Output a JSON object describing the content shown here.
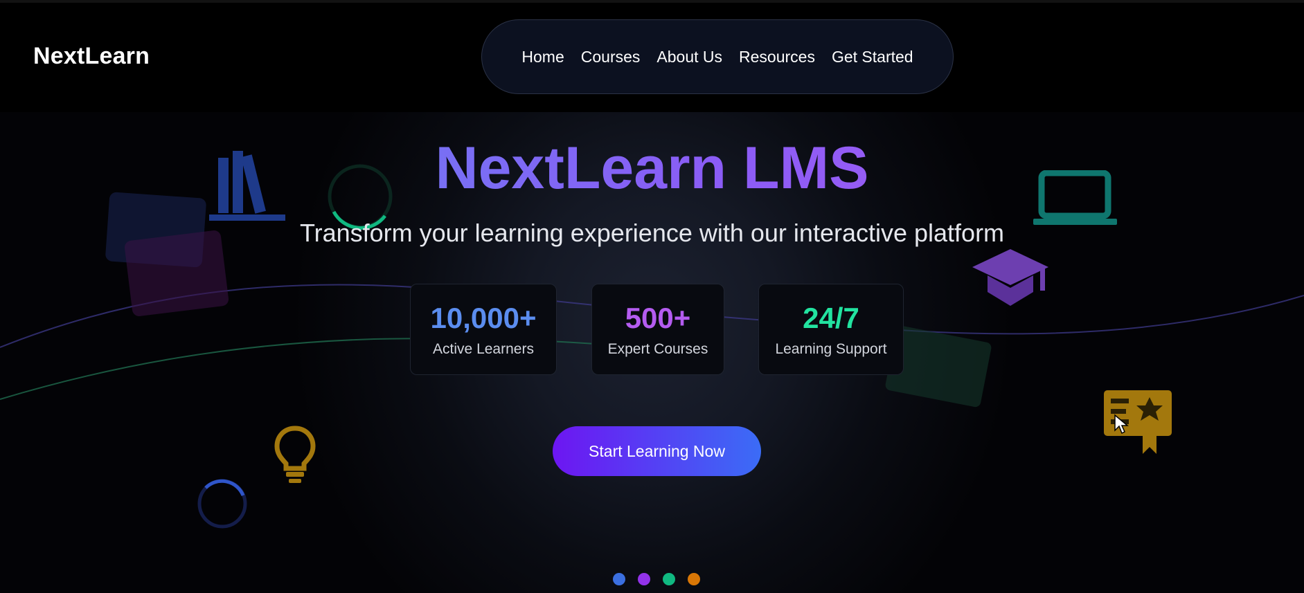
{
  "header": {
    "logo": "NextLearn",
    "nav": [
      "Home",
      "Courses",
      "About Us",
      "Resources",
      "Get Started"
    ]
  },
  "hero": {
    "title": "NextLearn LMS",
    "subtitle": "Transform your learning experience with our interactive platform",
    "stats": [
      {
        "value": "10,000+",
        "label": "Active Learners",
        "color": "#5b8def"
      },
      {
        "value": "500+",
        "label": "Expert Courses",
        "color": "#b45cf0"
      },
      {
        "value": "24/7",
        "label": "Learning Support",
        "color": "#22e3a0"
      }
    ],
    "cta": "Start Learning Now",
    "carousel_dots": [
      "#3b6fe0",
      "#9333ea",
      "#10b981",
      "#d97706"
    ]
  },
  "decorations": {
    "icons": [
      "books-icon",
      "laptop-icon",
      "graduation-cap-icon",
      "lightbulb-icon",
      "certificate-icon",
      "loading-ring-icon"
    ],
    "colors": {
      "blue": "#1e3a8a",
      "teal": "#0f766e",
      "purple": "#6d3fb0",
      "gold": "#a3780d",
      "green": "#10b981"
    }
  }
}
